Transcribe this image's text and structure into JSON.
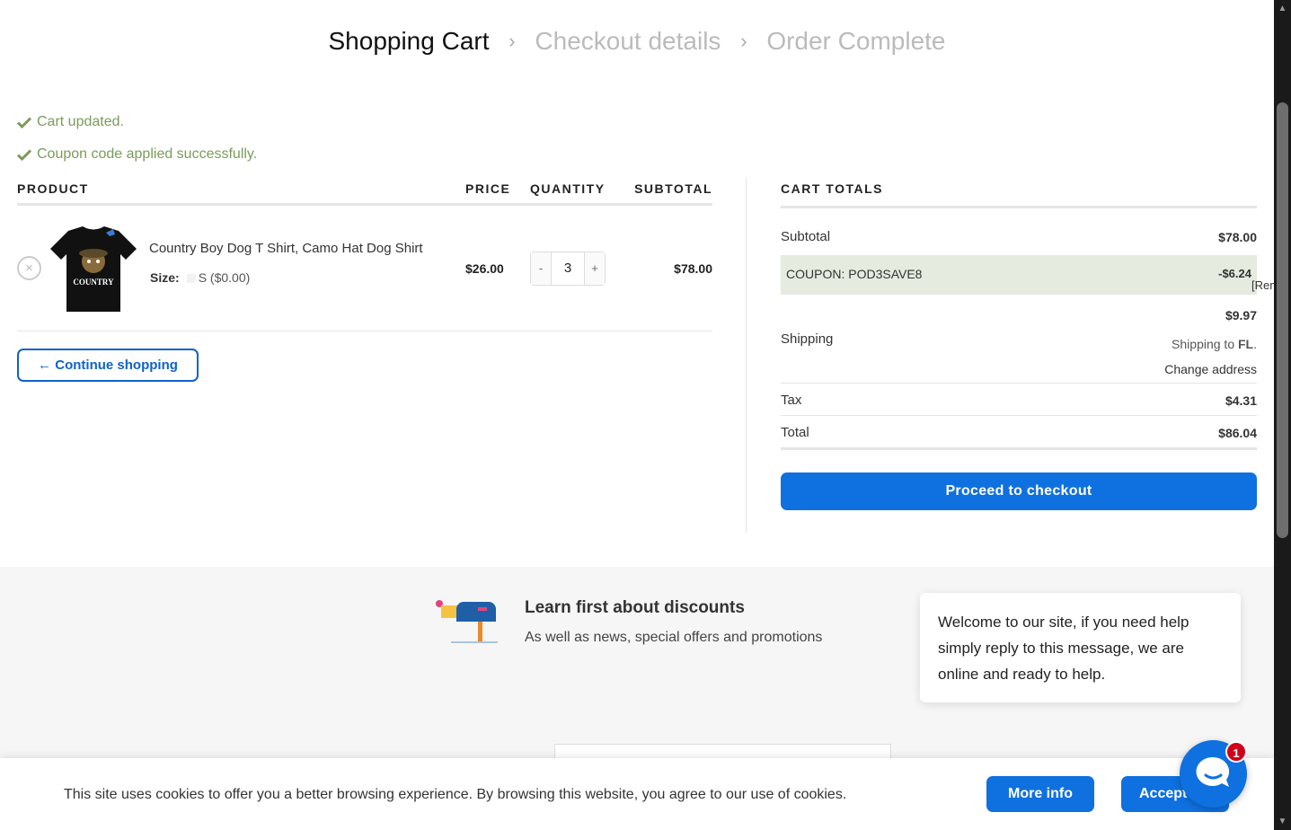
{
  "breadcrumb": {
    "step1": "Shopping Cart",
    "step2": "Checkout details",
    "step3": "Order Complete",
    "sep": "›"
  },
  "notices": [
    "Cart updated.",
    "Coupon code applied successfully."
  ],
  "cart": {
    "headers": {
      "product": "PRODUCT",
      "price": "PRICE",
      "quantity": "QUANTITY",
      "subtotal": "SUBTOTAL"
    },
    "item": {
      "remove": "×",
      "name": "Country Boy Dog T Shirt, Camo Hat Dog Shirt",
      "size_label": "Size:",
      "size_value": "S ($0.00)",
      "price": "$26.00",
      "qty_minus": "-",
      "qty_value": "3",
      "qty_plus": "+",
      "subtotal": "$78.00",
      "image_text": "COUNTRY"
    },
    "continue": "← Continue shopping"
  },
  "totals": {
    "title": "CART TOTALS",
    "subtotal_label": "Subtotal",
    "subtotal_value": "$78.00",
    "coupon_label": "COUPON: POD3SAVE8",
    "coupon_value": "-$6.24",
    "coupon_remove": "[Remove]",
    "shipping_label": "Shipping",
    "shipping_value": "$9.97",
    "shipping_to": "Shipping to ",
    "shipping_state": "FL",
    "shipping_dot": ".",
    "change_address": "Change address",
    "tax_label": "Tax",
    "tax_value": "$4.31",
    "total_label": "Total",
    "total_value": "$86.04",
    "checkout": "Proceed to checkout"
  },
  "newsletter": {
    "title": "Learn first about discounts",
    "subtitle": "As well as news, special offers and promotions"
  },
  "chat": {
    "message": "Welcome to our site, if you need help simply reply to this message, we are online and ready to help.",
    "badge": "1"
  },
  "cookie": {
    "text": "This site uses cookies to offer you a better browsing experience. By browsing this website, you agree to our use of cookies.",
    "more": "More info",
    "accept": "Accept"
  },
  "colors": {
    "accent": "#0f70e0",
    "success": "#7a9c59",
    "coupon_bg": "#e5ebde"
  }
}
